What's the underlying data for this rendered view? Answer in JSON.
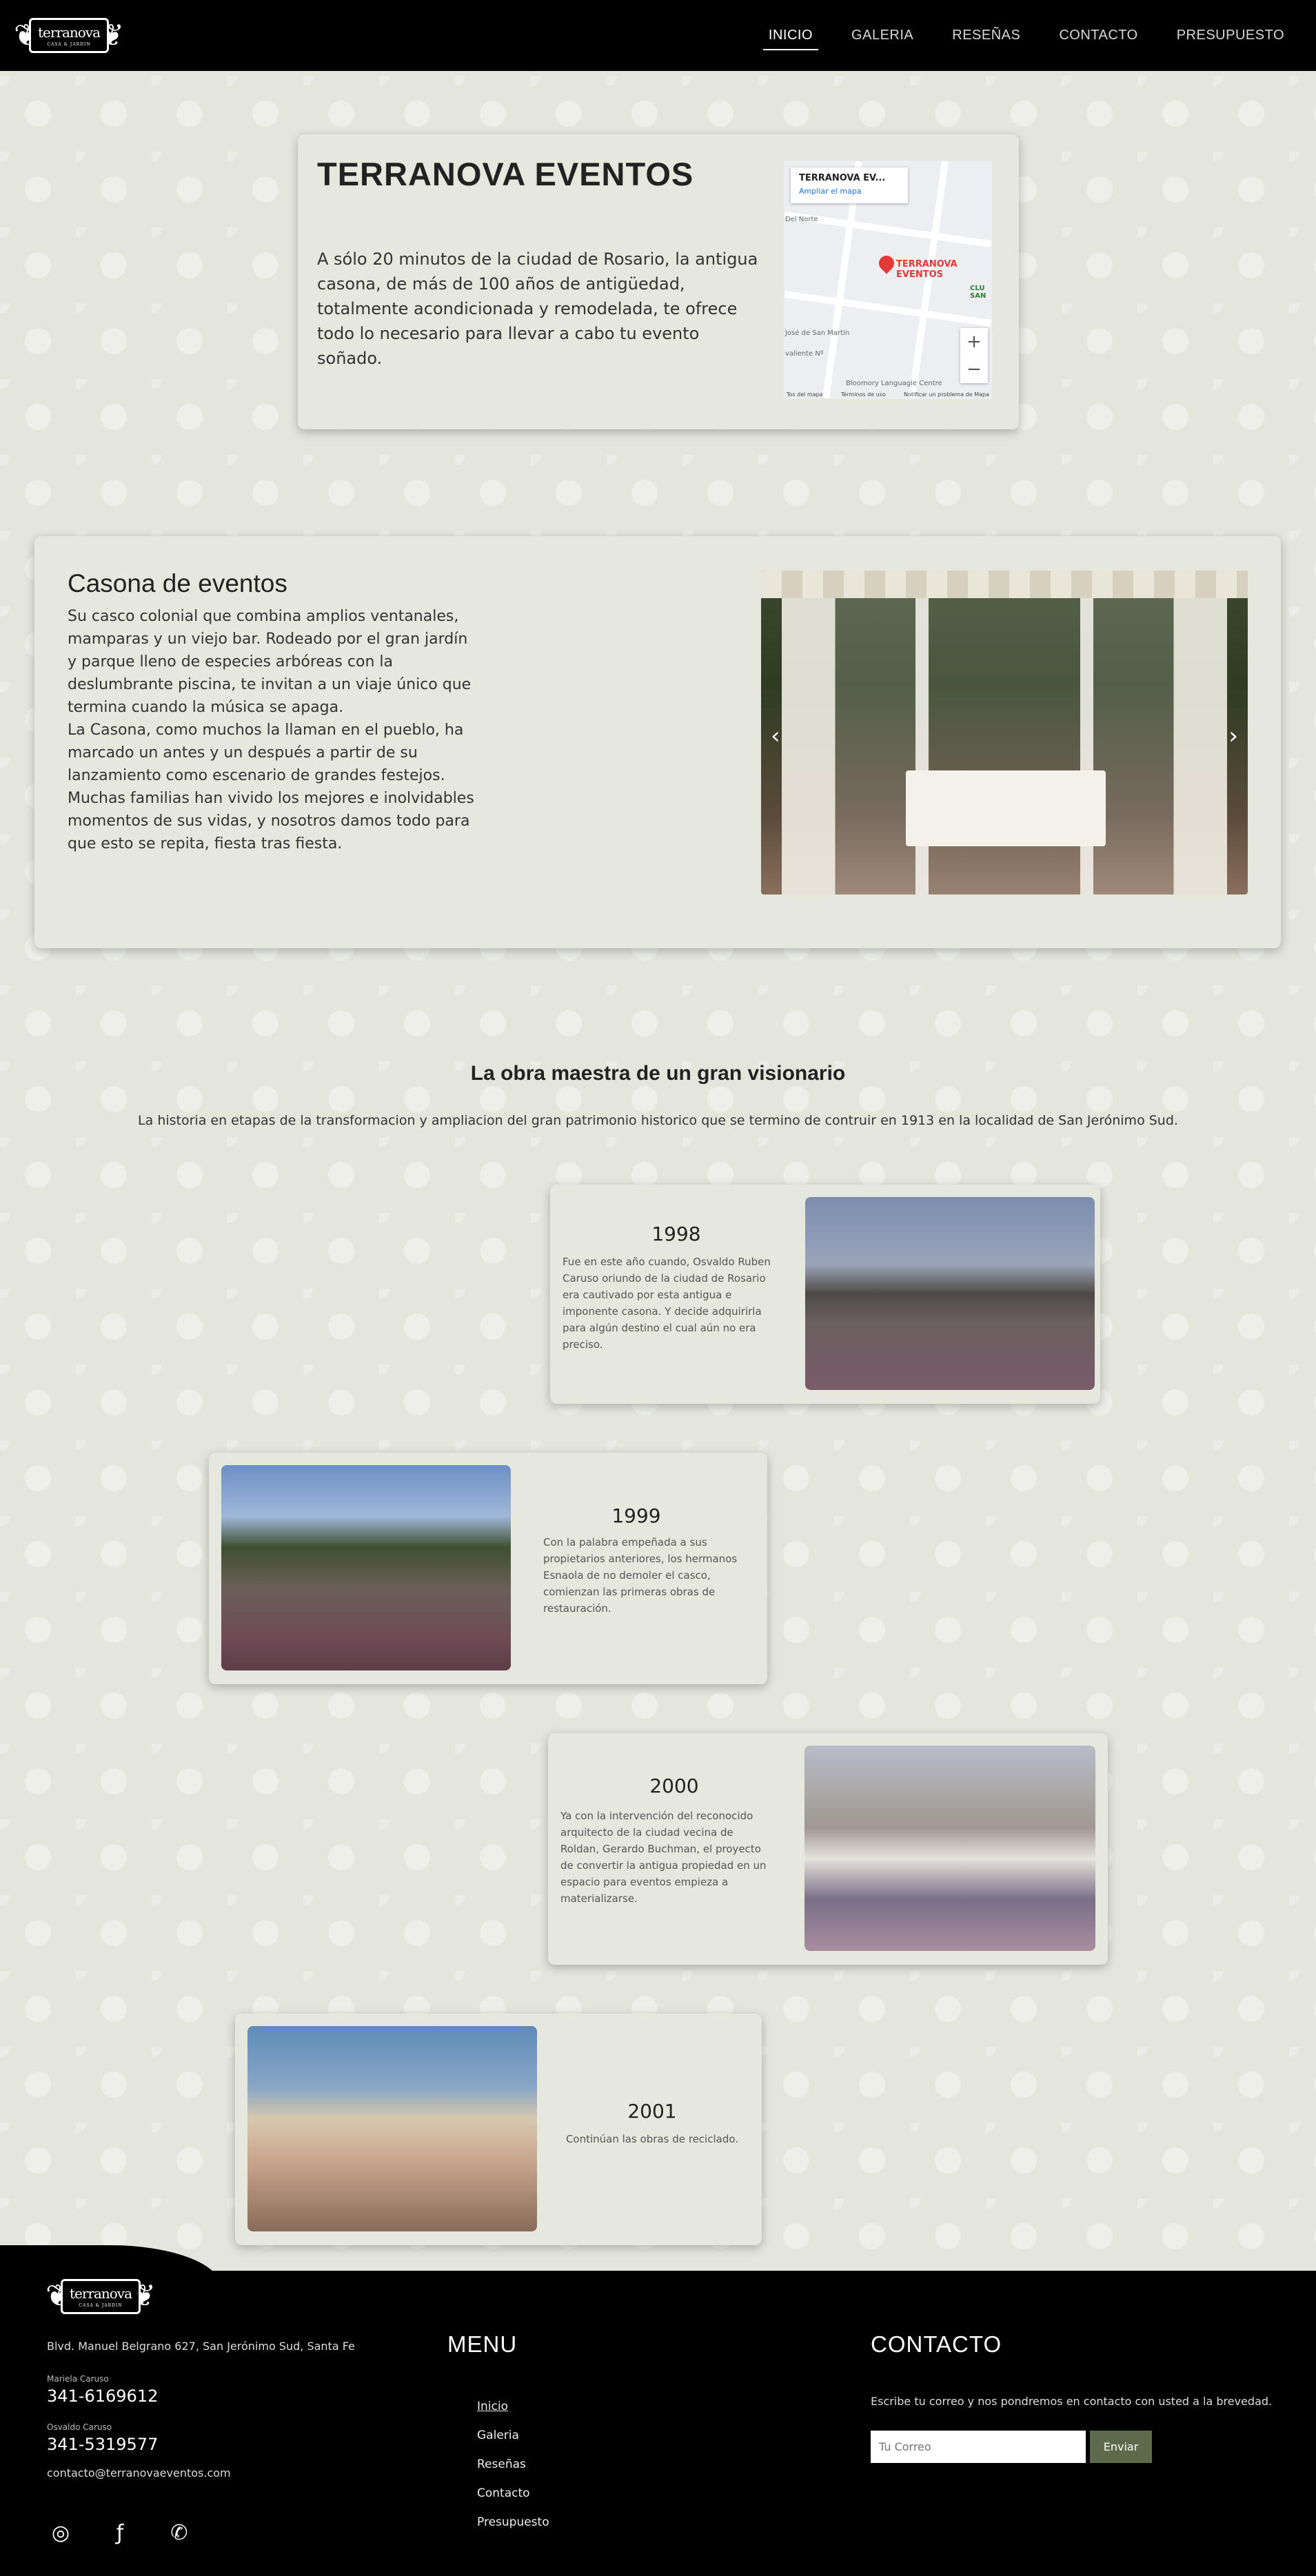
{
  "nav": {
    "logo_text": "terranova",
    "logo_sub": "CASA & JARDIN",
    "items": [
      "INICIO",
      "GALERIA",
      "RESEÑAS",
      "CONTACTO",
      "PRESUPUESTO"
    ]
  },
  "hero": {
    "title": "TERRANOVA EVENTOS",
    "text": "A sólo 20 minutos de la ciudad de Rosario, la antigua casona, de más de 100 años de antigüedad, totalmente acondicionada y remodelada, te ofrece todo lo necesario para llevar a cabo tu evento soñado.",
    "map": {
      "place": "TERRANOVA EV...",
      "link": "Ampliar el mapa",
      "pin_label": "TERRANOVA EVENTOS",
      "labels": [
        "Del Norte",
        "José de San Martín",
        "valiente Nº",
        "Bloomory Languagie Centre",
        "CLU SAN"
      ],
      "zoom_in": "+",
      "zoom_out": "−",
      "footer": [
        "Tos del mapa",
        "Términos de uso",
        "Notificar un problema de Mapa"
      ]
    }
  },
  "casona": {
    "title": "Casona de eventos",
    "p1": "Su casco colonial que combina amplios ventanales, mamparas y un viejo bar. Rodeado por el gran jardín y parque lleno de especies arbóreas con la deslumbrante piscina, te invitan a un viaje único que termina cuando la música se apaga.",
    "p2": "La Casona, como muchos la llaman en el pueblo, ha marcado un antes y un después a partir de su lanzamiento como escenario de grandes festejos. Muchas familias han vivido los mejores e inolvidables momentos de sus vidas, y nosotros damos todo para que esto se repita, fiesta tras fiesta.",
    "prev": "‹",
    "next": "›"
  },
  "history": {
    "title": "La obra maestra de un gran visionario",
    "subtitle": "La historia en etapas de la transformacion y ampliacion del gran patrimonio historico que se termino de contruir en 1913 en la localidad de San Jerónimo Sud.",
    "items": [
      {
        "year": "1998",
        "text": "Fue en este año cuando, Osvaldo Ruben Caruso oriundo de la ciudad de Rosario era cautivado por esta antigua e imponente casona. Y decide adquirirla para algún destino el cual aún no era preciso."
      },
      {
        "year": "1999",
        "text": "Con la palabra empeñada a sus propietarios anteriores, los hermanos Esnaola de no demoler el casco, comienzan las primeras obras de restauración."
      },
      {
        "year": "2000",
        "text": "Ya con la intervención del reconocido arquitecto de la ciudad vecina de Roldan, Gerardo Buchman, el proyecto de convertir la antigua propiedad en un espacio para eventos empieza a materializarse."
      },
      {
        "year": "2001",
        "text": "Continúan las obras de reciclado."
      }
    ]
  },
  "footer": {
    "address": "Blvd. Manuel Belgrano 627, San Jerónimo Sud, Santa Fe",
    "contact1_name": "Mariela Caruso",
    "contact1_phone": "341-6169612",
    "contact2_name": "Osvaldo Caruso",
    "contact2_phone": "341-5319577",
    "email": "contacto@terranovaeventos.com",
    "menu_title": "MENU",
    "menu": [
      "Inicio",
      "Galeria",
      "Reseñas",
      "Contacto",
      "Presupuesto"
    ],
    "contact_title": "CONTACTO",
    "contact_text": "Escribe tu correo y nos pondremos en contacto con usted a la brevedad.",
    "email_placeholder": "Tu Correo",
    "send": "Enviar"
  }
}
